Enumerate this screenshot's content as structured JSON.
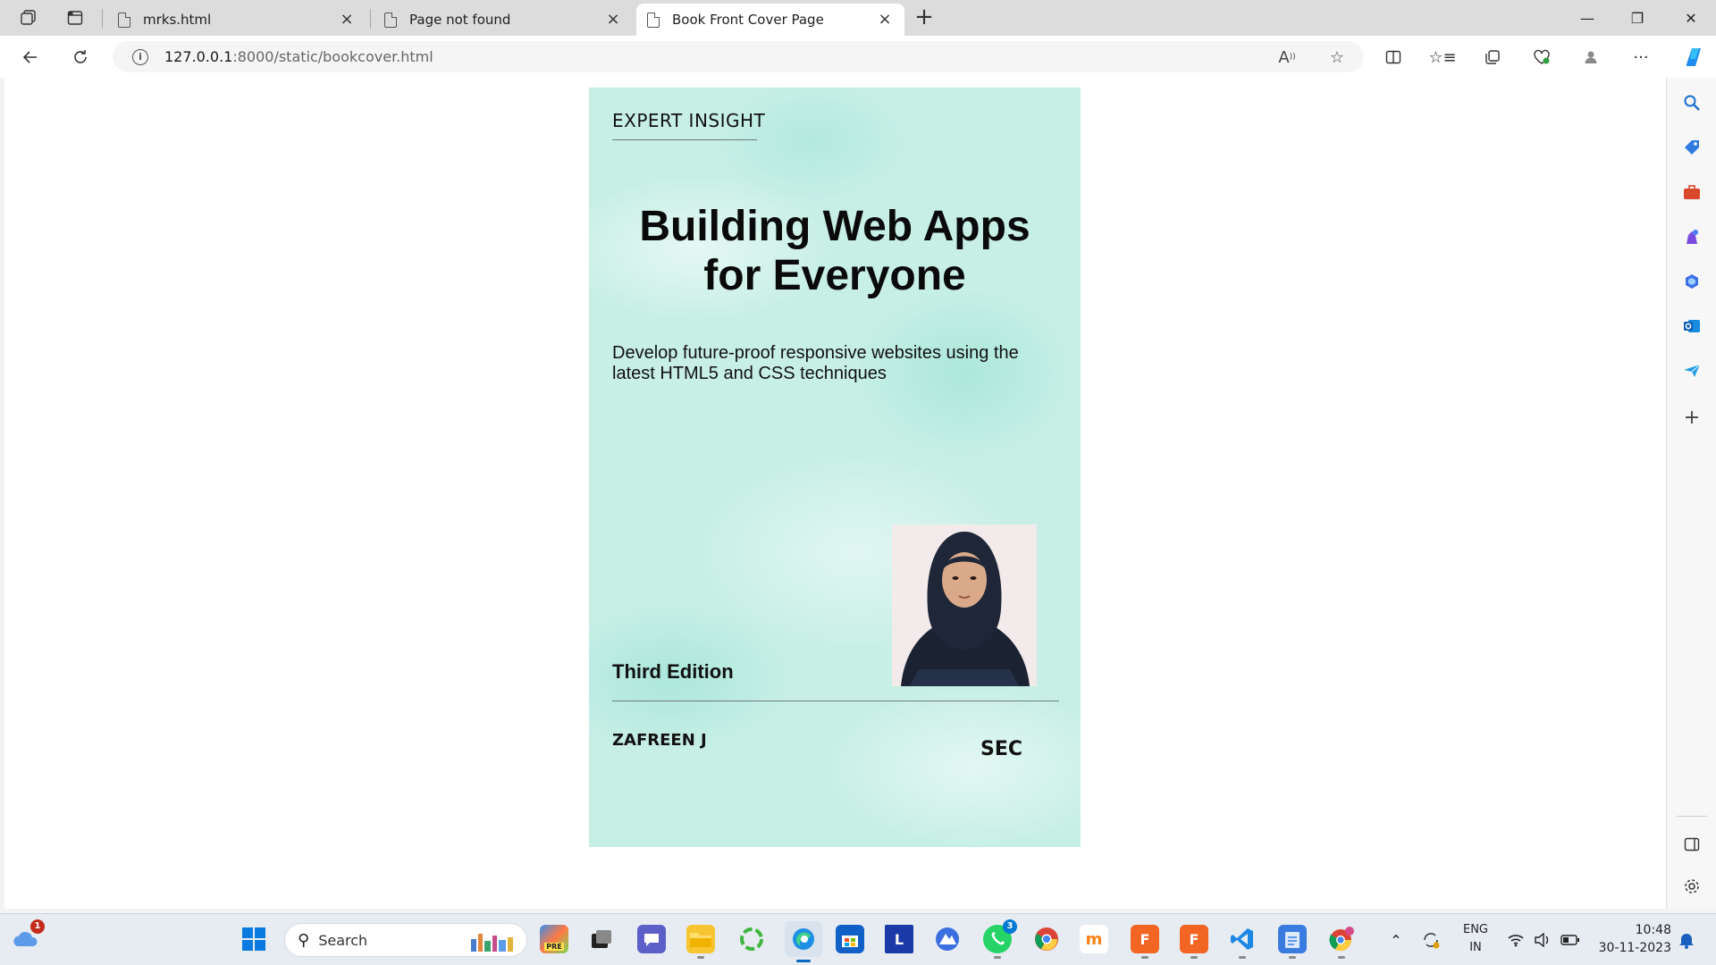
{
  "tabs": [
    {
      "title": "mrks.html",
      "close": "×"
    },
    {
      "title": "Page not found",
      "close": "×"
    },
    {
      "title": "Book Front Cover Page",
      "close": "×"
    }
  ],
  "new_tab_label": "+",
  "window_controls": {
    "minimize": "—",
    "restore": "❐",
    "close": "✕"
  },
  "address_bar": {
    "host": "127.0.0.1",
    "path": ":8000/static/bookcover.html"
  },
  "book": {
    "label": "EXPERT INSIGHT",
    "title_line1": "Building Web Apps",
    "title_line2": "for Everyone",
    "subtitle": "Develop future-proof responsive websites using the latest HTML5 and CSS techniques",
    "edition": "Third Edition",
    "author": "ZAFREEN J",
    "publisher": "SEC"
  },
  "taskbar": {
    "search_placeholder": "Search",
    "weather_badge": "1",
    "whatsapp_badge": "3",
    "language_line1": "ENG",
    "language_line2": "IN",
    "time": "10:48",
    "date": "30-11-2023"
  },
  "colors": {
    "cover_bg": "#c7efe6",
    "accent": "#0067c0",
    "badge": "#c42b1c"
  }
}
